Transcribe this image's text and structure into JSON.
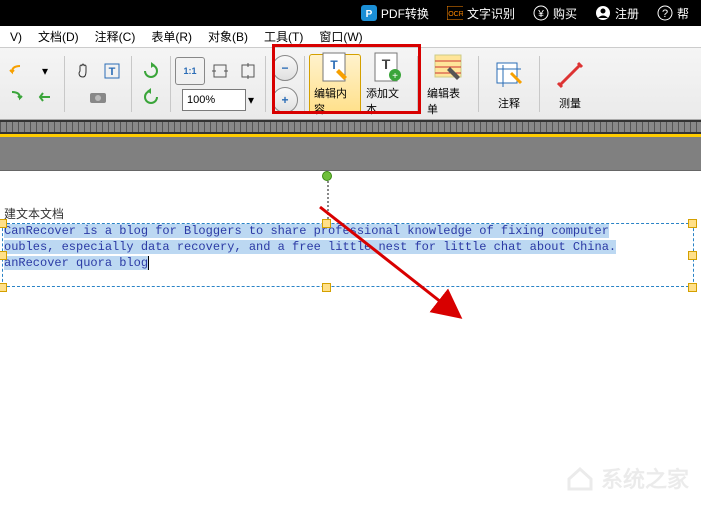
{
  "topbar": {
    "pdf_convert": "PDF转换",
    "ocr": "文字识别",
    "ocr_badge": "OCR",
    "buy": "购买",
    "register": "注册",
    "help": "帮"
  },
  "menu": {
    "view": "V)",
    "doc": "文档(D)",
    "comment": "注释(C)",
    "form": "表单(R)",
    "object": "对象(B)",
    "tools": "工具(T)",
    "window": "窗口(W)"
  },
  "toolbar": {
    "zoom_value": "100%",
    "edit_content": "编辑内容",
    "add_text": "添加文本",
    "edit_form": "编辑表单",
    "annotate": "注释",
    "measure": "测量",
    "zoom_fit": "1:1"
  },
  "document": {
    "title": "建文本文档",
    "line1": "CanRecover is a blog for Bloggers to share professional knowledge of fixing computer",
    "line2": "oubles, especially data recovery, and a free little nest for little chat about China.",
    "line3": "anRecover quora blog"
  },
  "watermark": "系统之家"
}
